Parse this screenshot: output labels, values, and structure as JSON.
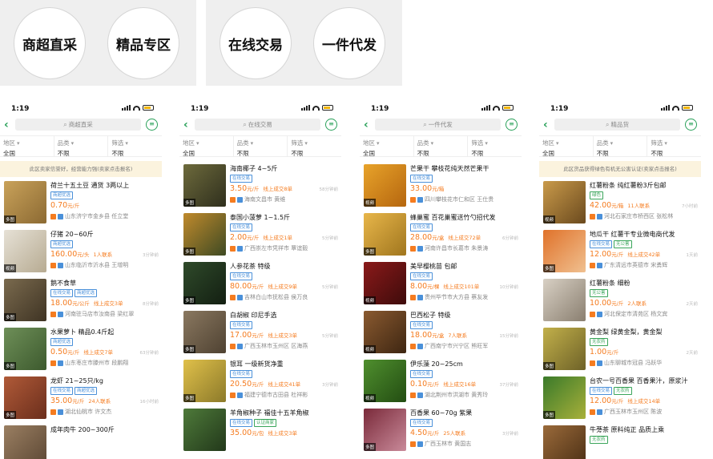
{
  "banners": {
    "left": [
      "商超直采",
      "精品专区"
    ],
    "right": [
      "在线交易",
      "一件代发"
    ]
  },
  "phones": [
    {
      "time": "1:19",
      "search": "商超直采",
      "filters": [
        {
          "label": "地区",
          "value": "全国"
        },
        {
          "label": "品类",
          "value": "不限"
        },
        {
          "label": "筛选",
          "value": "不限"
        }
      ],
      "notice": "此区卖家信誉好，经营能力强(卖家点击报名)",
      "items": [
        {
          "title": "荷兰十五土豆 通货 3两以上",
          "badges": [
            "商超优选"
          ],
          "price": "0.70",
          "unit": "元/斤",
          "deal": "",
          "ago": "",
          "seller": "山东济宁市金乡县 任立堂",
          "tag": "多图",
          "colors": [
            "#c9a25a",
            "#8c6a33"
          ]
        },
        {
          "title": "仔猪 20~60斤",
          "badges": [
            "商超优选"
          ],
          "price": "160.00",
          "unit": "元/头",
          "deal": "1人联系",
          "ago": "3分钟前",
          "seller": "山东临沂市沂水县 王增明",
          "tag": "视频",
          "colors": [
            "#e6e1d6",
            "#b7ab92"
          ]
        },
        {
          "title": "鹅不食草",
          "badges": [
            "在线交易",
            "商超优选"
          ],
          "price": "18.00",
          "unit": "元/公斤",
          "deal": "线上成交3单",
          "ago": "8分钟前",
          "seller": "河南驻马店市汝南县 梁红翠",
          "tag": "多图",
          "colors": [
            "#7a6a4e",
            "#3f3424"
          ]
        },
        {
          "title": "水果萝卜 精品0.4斤起",
          "badges": [
            "商超优选"
          ],
          "price": "0.50",
          "unit": "元/斤",
          "deal": "线上成交7单",
          "ago": "63分钟前",
          "seller": "山东枣庄市滕州市 段鹏翔",
          "tag": "多图",
          "colors": [
            "#6e8f58",
            "#3d5a2e"
          ]
        },
        {
          "title": "龙虾 21~25只/kg",
          "badges": [
            "在线交易",
            "商超优选"
          ],
          "price": "35.00",
          "unit": "元/斤",
          "deal": "24人联系",
          "ago": "16小时前",
          "seller": "湖北仙桃市 许文杰",
          "tag": "多图",
          "colors": [
            "#b05a38",
            "#6b2e1c"
          ]
        },
        {
          "title": "成年肉牛 200~300斤",
          "badges": [],
          "price": "",
          "unit": "",
          "deal": "",
          "ago": "",
          "seller": "",
          "tag": "",
          "colors": [
            "#9a7f62",
            "#5b4633"
          ]
        }
      ]
    },
    {
      "time": "1:19",
      "search": "在线交易",
      "filters": [
        {
          "label": "地区",
          "value": "全国"
        },
        {
          "label": "品类",
          "value": "不限"
        },
        {
          "label": "筛选",
          "value": "不限"
        }
      ],
      "notice": "",
      "items": [
        {
          "title": "海南椰子 4~5斤",
          "badges": [
            "在线交易"
          ],
          "price": "3.50",
          "unit": "元/斤",
          "deal": "线上成交8单",
          "ago": "58分钟前",
          "seller": "海南文昌市 黄维",
          "tag": "多图",
          "colors": [
            "#6d6a3c",
            "#2f2f1d"
          ]
        },
        {
          "title": "泰国小菠萝 1~1.5斤",
          "badges": [
            "在线交易"
          ],
          "price": "2.00",
          "unit": "元/斤",
          "deal": "线上成交1单",
          "ago": "5分钟前",
          "seller": "广西崇左市凭祥市 覃谊毅",
          "tag": "多图",
          "colors": [
            "#c08a2c",
            "#3e4a23"
          ]
        },
        {
          "title": "人参花茶 特级",
          "badges": [
            "在线交易"
          ],
          "price": "80.00",
          "unit": "元/斤",
          "deal": "线上成交9单",
          "ago": "5分钟前",
          "seller": "吉林白山市抚松县 侯万良",
          "tag": "多图",
          "colors": [
            "#2f4a2a",
            "#131f12"
          ]
        },
        {
          "title": "白胡椒 印尼手选",
          "badges": [
            "在线交易"
          ],
          "price": "17.00",
          "unit": "元/斤",
          "deal": "线上成交3单",
          "ago": "5分钟前",
          "seller": "广西玉林市玉州区 区海燕",
          "tag": "多图",
          "colors": [
            "#8a7860",
            "#4f4232"
          ]
        },
        {
          "title": "银耳 一级新货净重",
          "badges": [
            "在线交易"
          ],
          "price": "20.50",
          "unit": "元/斤",
          "deal": "线上成交41单",
          "ago": "3分钟前",
          "seller": "福建宁德市古田县 杜祥彬",
          "tag": "多图",
          "colors": [
            "#e0c04a",
            "#8c7a2a"
          ]
        },
        {
          "title": "羊角椒种子 福佳十五羊角椒",
          "badges": [
            "在线交易",
            "认证商家"
          ],
          "price": "35.00",
          "unit": "元/包",
          "deal": "线上成交3单",
          "ago": "",
          "seller": "",
          "tag": "",
          "colors": [
            "#4e7a3a",
            "#22381a"
          ]
        }
      ]
    },
    {
      "time": "1:19",
      "search": "一件代发",
      "filters": [
        {
          "label": "地区",
          "value": "全国"
        },
        {
          "label": "品类",
          "value": "不限"
        },
        {
          "label": "筛选",
          "value": "不限"
        }
      ],
      "notice": "",
      "items": [
        {
          "title": "芒果干 攀枝花纯天然芒果干",
          "badges": [
            "在线交易"
          ],
          "price": "33.00",
          "unit": "元/箱",
          "deal": "",
          "ago": "",
          "seller": "四川攀枝花市仁和区 王仕贵",
          "tag": "视频",
          "colors": [
            "#e8a32a",
            "#b5660f"
          ]
        },
        {
          "title": "蜂巢蜜 百花巢蜜送竹勺招代发",
          "badges": [
            "在线交易"
          ],
          "price": "28.00",
          "unit": "元/盒",
          "deal": "线上成交72单",
          "ago": "6分钟前",
          "seller": "河南许昌市长葛市 朱景涛",
          "tag": "多图",
          "colors": [
            "#e8b64a",
            "#a0761e"
          ]
        },
        {
          "title": "美早樱桃苗 包邮",
          "badges": [
            "在线交易"
          ],
          "price": "8.00",
          "unit": "元/棵",
          "deal": "线上成交101单",
          "ago": "10分钟前",
          "seller": "贵州毕节市大方县 蔡友发",
          "tag": "视频",
          "colors": [
            "#8a1a1a",
            "#3e0b0b"
          ]
        },
        {
          "title": "巴西松子 特级",
          "badges": [
            "在线交易"
          ],
          "price": "18.00",
          "unit": "元/盒",
          "deal": "7人联系",
          "ago": "15分钟前",
          "seller": "广西南宁市兴宁区 熊旺军",
          "tag": "视频",
          "colors": [
            "#8a5a30",
            "#3e2612"
          ]
        },
        {
          "title": "伊乐藻 20~25cm",
          "badges": [
            "在线交易"
          ],
          "price": "0.10",
          "unit": "元/斤",
          "deal": "线上成交16单",
          "ago": "37分钟前",
          "seller": "湖北荆州市洪湖市 黄秀玲",
          "tag": "视频",
          "colors": [
            "#4f8f2e",
            "#234d12"
          ]
        },
        {
          "title": "百香果 60~70g 紫果",
          "badges": [
            "在线交易"
          ],
          "price": "4.50",
          "unit": "元/斤",
          "deal": "25人联系",
          "ago": "3分钟前",
          "seller": "广西玉林市 黄国志",
          "tag": "多图",
          "colors": [
            "#7a2a3a",
            "#c98a9a"
          ]
        }
      ]
    },
    {
      "time": "1:19",
      "search": "精品货",
      "filters": [
        {
          "label": "地区",
          "value": "全国"
        },
        {
          "label": "品类",
          "value": "不限"
        },
        {
          "label": "筛选",
          "value": "不限"
        }
      ],
      "notice": "此区货品获得绿色有机无公害认证(卖家点击报名)",
      "items": [
        {
          "title": "红薯粉条 纯红薯粉3斤包邮",
          "badges": [
            "绿色"
          ],
          "price": "42.00",
          "unit": "元/箱",
          "deal": "11人联系",
          "ago": "7小时前",
          "seller": "河北石家庄市桥西区 张松林",
          "tag": "视频",
          "colors": [
            "#c99a4a",
            "#6b4a1e"
          ]
        },
        {
          "title": "地瓜干 红薯干专业微电商代发",
          "badges": [
            "在线交易",
            "无公害"
          ],
          "price": "12.00",
          "unit": "元/斤",
          "deal": "线上成交42单",
          "ago": "1天前",
          "seller": "广东清远市英德市 宋勇辉",
          "tag": "多图",
          "colors": [
            "#e0722a",
            "#f0c090"
          ]
        },
        {
          "title": "红薯粉条 细粉",
          "badges": [
            "无公害"
          ],
          "price": "10.00",
          "unit": "元/斤",
          "deal": "2人联系",
          "ago": "2天前",
          "seller": "河北保定市清苑区 杨文宾",
          "tag": "",
          "colors": [
            "#d8d0c4",
            "#8a7f70"
          ]
        },
        {
          "title": "黄金梨 绿黄金梨，黄金梨",
          "badges": [
            "无农药"
          ],
          "price": "1.00",
          "unit": "元/斤",
          "deal": "",
          "ago": "2天前",
          "seller": "山东聊城市冠县 冯跃华",
          "tag": "多图",
          "colors": [
            "#c2b04a",
            "#6e6228"
          ]
        },
        {
          "title": "台农一号百香果 百香果汁，原浆汁",
          "badges": [
            "在线交易",
            "无农药"
          ],
          "price": "12.00",
          "unit": "元/斤",
          "deal": "线上成交14单",
          "ago": "",
          "seller": "广西玉林市玉州区 陈波",
          "tag": "多图",
          "colors": [
            "#3a7a2a",
            "#a8b03a"
          ]
        },
        {
          "title": "牛蒡茶 原料纯正 品质上乘",
          "badges": [
            "无农药"
          ],
          "price": "",
          "unit": "",
          "deal": "",
          "ago": "",
          "seller": "",
          "tag": "",
          "colors": [
            "#9a6a3a",
            "#4a2e14"
          ]
        }
      ]
    }
  ]
}
